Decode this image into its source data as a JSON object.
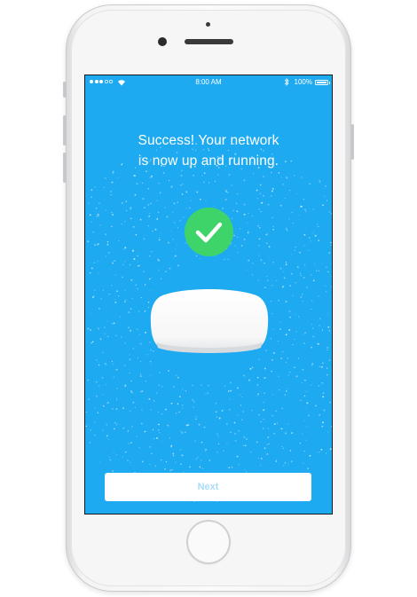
{
  "status_bar": {
    "time": "8:00 AM",
    "battery": "100%",
    "signal_icon": "cellular-signal-icon",
    "wifi_icon": "wifi-icon",
    "bluetooth_icon": "bluetooth-icon",
    "battery_icon": "battery-icon",
    "battery_level": 1.0
  },
  "main": {
    "headline_line1": "Success! Your network",
    "headline_line2": "is now up and running.",
    "status_icon": "checkmark-icon",
    "device_icon": "router-icon"
  },
  "actions": {
    "next_label": "Next"
  },
  "colors": {
    "background": "#1eaaf1",
    "success": "#3fd46a",
    "button_text": "#a9dcf8"
  }
}
